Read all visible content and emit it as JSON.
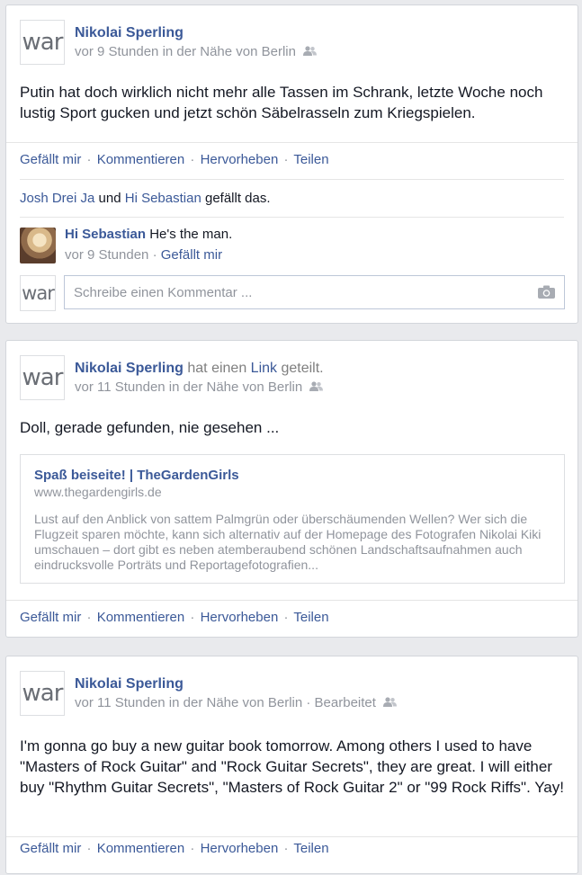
{
  "posts": [
    {
      "avatar_text": "war",
      "author": "Nikolai Sperling",
      "meta": "vor 9 Stunden in der Nähe von Berlin",
      "text": "Putin hat doch wirklich nicht mehr alle Tassen im Schrank, letzte Woche noch lustig Sport gucken und jetzt schön Säbelrasseln zum Kriegspielen.",
      "actions": {
        "like": "Gefällt mir",
        "comment": "Kommentieren",
        "highlight": "Hervorheben",
        "share": "Teilen",
        "sep": "·"
      },
      "likes": {
        "person1": "Josh Drei Ja",
        "and": "und",
        "person2": "Hi Sebastian",
        "suffix": "gefällt das."
      },
      "comment": {
        "author": "Hi Sebastian",
        "text": "He's the man.",
        "time": "vor 9 Stunden",
        "like": "Gefällt mir"
      },
      "comment_input": {
        "avatar_text": "war",
        "placeholder": "Schreibe einen Kommentar ..."
      }
    },
    {
      "avatar_text": "war",
      "author": "Nikolai Sperling",
      "shared_prefix": "hat einen",
      "shared_link_word": "Link",
      "shared_suffix": "geteilt.",
      "meta": "vor 11 Stunden in der Nähe von Berlin",
      "text": "Doll, gerade gefunden, nie gesehen ...",
      "link": {
        "title": "Spaß beiseite! | TheGardenGirls",
        "domain": "www.thegardengirls.de",
        "description": "Lust auf den Anblick von sattem Palmgrün oder überschäumenden Wellen? Wer sich die Flugzeit sparen möchte, kann sich alternativ auf der Homepage des Fotografen Nikolai Kiki umschauen – dort gibt es neben atemberaubend schönen Landschaftsaufnahmen auch eindrucksvolle Porträts und Reportagefotografien..."
      },
      "actions": {
        "like": "Gefällt mir",
        "comment": "Kommentieren",
        "highlight": "Hervorheben",
        "share": "Teilen",
        "sep": "·"
      }
    },
    {
      "avatar_text": "war",
      "author": "Nikolai Sperling",
      "meta": "vor 11 Stunden in der Nähe von Berlin · Bearbeitet",
      "text": "I'm gonna go buy a new guitar book tomorrow. Among others I used to have \"Masters of Rock Guitar\" and \"Rock Guitar Secrets\", they are great. I will either buy \"Rhythm Guitar Secrets\", \"Masters of Rock Guitar 2\" or \"99 Rock Riffs\". Yay!",
      "actions": {
        "like": "Gefällt mir",
        "comment": "Kommentieren",
        "highlight": "Hervorheben",
        "share": "Teilen",
        "sep": "·"
      }
    }
  ],
  "icons": {
    "audience": "friends-icon",
    "camera": "camera-icon"
  },
  "colors": {
    "link": "#3b5998",
    "background": "#e9eaed",
    "meta": "#90949c"
  }
}
